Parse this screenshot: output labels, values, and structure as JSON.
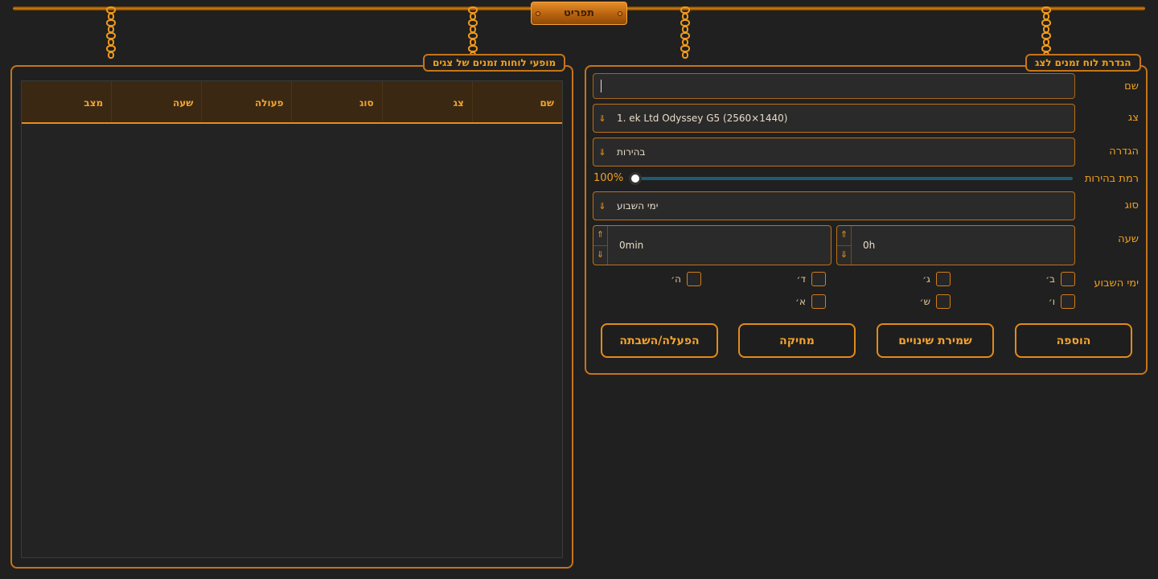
{
  "menu": {
    "label": "תפריט"
  },
  "left_panel": {
    "title": "מופעי לוחות זמנים של צגים",
    "columns": [
      "שם",
      "צג",
      "סוג",
      "פעולה",
      "שעה",
      "מצב"
    ],
    "rows": []
  },
  "right_panel": {
    "title": "הגדרת לוח זמנים לצג",
    "name": {
      "label": "שם",
      "value": ""
    },
    "display": {
      "label": "צג",
      "value": "1. ek Ltd Odyssey G5 (2560×1440)"
    },
    "setting": {
      "label": "הגדרה",
      "value": "בהירות"
    },
    "brightness": {
      "label": "רמת בהירות",
      "value": "100%",
      "level": 1.0
    },
    "type": {
      "label": "סוג",
      "value": "ימי השבוע"
    },
    "time": {
      "label": "שעה",
      "hours": "0h",
      "minutes": "0min"
    },
    "weekdays": {
      "label": "ימי השבוע",
      "days": [
        {
          "label": "ב׳",
          "checked": false
        },
        {
          "label": "ג׳",
          "checked": false
        },
        {
          "label": "ד׳",
          "checked": false
        },
        {
          "label": "ה׳",
          "checked": false
        },
        {
          "label": "ו׳",
          "checked": false
        },
        {
          "label": "ש׳",
          "checked": false
        },
        {
          "label": "א׳",
          "checked": false
        }
      ]
    },
    "buttons": {
      "add": "הוספה",
      "save": "שמירת שינויים",
      "delete": "מחיקה",
      "toggle": "הפעלה/השבתה"
    }
  },
  "colors": {
    "accent": "#f0a020",
    "border": "#c7741a",
    "background": "#202020",
    "slider": "#1f5c72"
  },
  "icons": {
    "combo_arrow": "arrow-down-icon",
    "spin_up": "arrow-up-icon",
    "spin_down": "arrow-down-icon"
  }
}
